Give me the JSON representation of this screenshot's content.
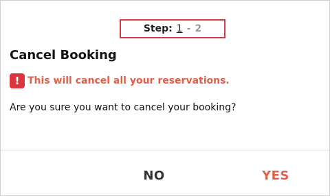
{
  "step": {
    "label": "Step:",
    "current": "1",
    "separator": "-",
    "next": "2",
    "highlight_color": "#d9363e"
  },
  "dialog": {
    "title": "Cancel Booking",
    "warning": {
      "icon": "exclamation-icon",
      "icon_glyph": "!",
      "text": "This will cancel all your reservations.",
      "color": "#e0604a"
    },
    "question": "Are you sure you want to cancel your booking?"
  },
  "actions": {
    "no_label": "NO",
    "yes_label": "YES",
    "yes_color": "#e0604a"
  }
}
